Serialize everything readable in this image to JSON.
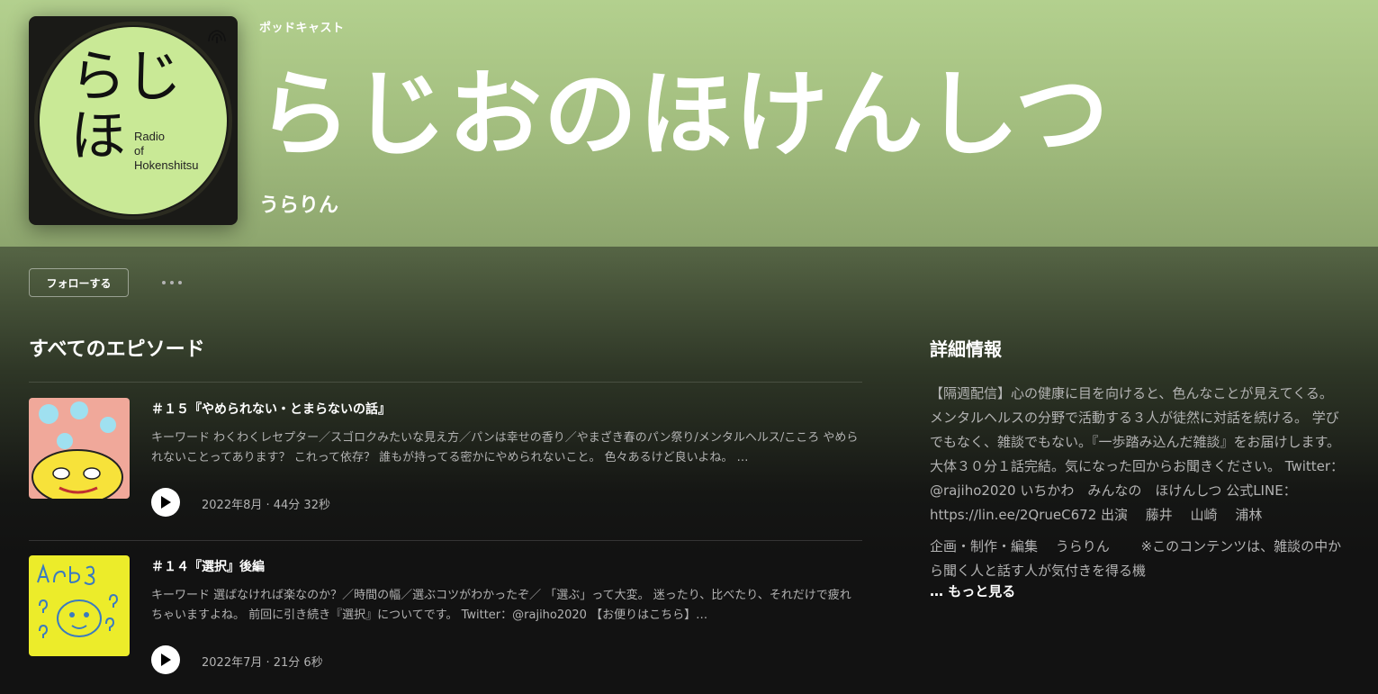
{
  "header": {
    "overline": "ポッドキャスト",
    "title": "らじおのほけんしつ",
    "author": "うらりん"
  },
  "cover": {
    "big_text_line1": "らじ",
    "big_text_line2": "ほ",
    "small_line1": "Radio",
    "small_line2": "of",
    "small_line3": "Hokenshitsu",
    "icon": "podcast-signal-icon"
  },
  "actions": {
    "follow_label": "フォローする",
    "more_icon": "more-dots-icon"
  },
  "episodes_section": {
    "title": "すべてのエピソード",
    "episodes": [
      {
        "title": "＃１５『やめられない・とまらないの話』",
        "description": "キーワード わくわくレセプター／スゴロクみたいな見え方／パンは幸せの香り／やまざき春のパン祭り/メンタルヘルス/こころ やめられないことってあります？ これって依存？ 誰もが持ってる密かにやめられないこと。 色々あるけど良いよね。 …",
        "meta": "2022年8月 · 44分 32秒"
      },
      {
        "title": "＃１４『選択』後編",
        "description": "キーワード 選ばなければ楽なのか？／時間の幅／選ぶコツがわかったぞ／ 「選ぶ」って大変。 迷ったり、比べたり、それだけで疲れちゃいますよね。 前回に引き続き『選択』についてです。 Twitter：@rajiho2020 【お便りはこちら】…",
        "meta": "2022年7月 · 21分 6秒"
      }
    ]
  },
  "details": {
    "title": "詳細情報",
    "paragraph1": "【隔週配信】心の健康に目を向けると、色んなことが見えてくる。 メンタルヘルスの分野で活動する３人が徒然に対話を続ける。 学びでもなく、雑談でもない。『一歩踏み込んだ雑談』をお届けします。 大体３０分１話完結。気になった回からお聞きください。 Twitter：@rajiho2020 いちかわ　みんなの　ほけんしつ 公式LINE：https://lin.ee/2QrueC672 出演　 藤井　 山崎　 浦林",
    "paragraph2": "企画・制作・編集　 うらりん　　 ※このコンテンツは、雑談の中から聞く人と話す人が気付きを得る機",
    "show_more": "… もっと見る"
  },
  "colors": {
    "header_green": "#b3d08e",
    "cover_circle": "#c9e996",
    "thumb1_bg": "#f0a89a",
    "thumb2_bg": "#ecec2a"
  }
}
